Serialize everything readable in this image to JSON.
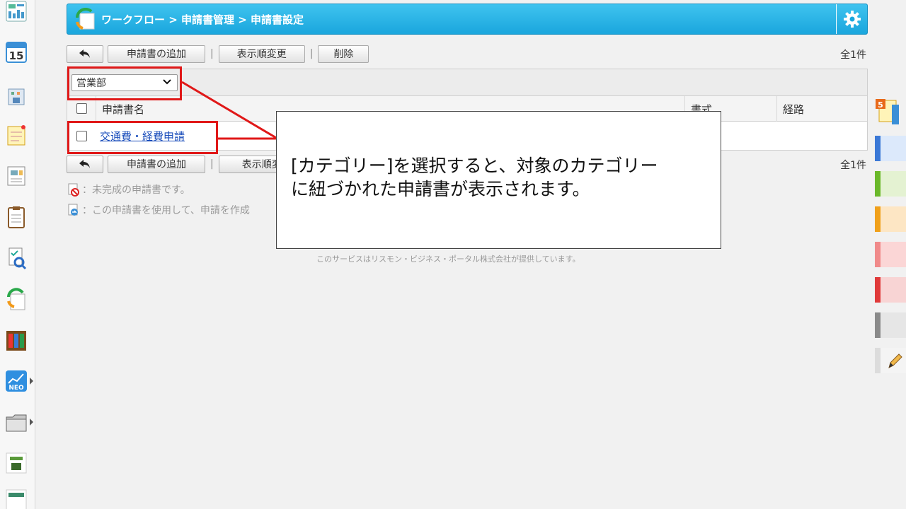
{
  "header": {
    "breadcrumb": "ワークフロー > 申請書管理 > 申請書設定"
  },
  "toolbar": {
    "add_label": "申請書の追加",
    "sort_label": "表示順変更",
    "delete_label": "削除",
    "separator": "|",
    "count_label": "全1件"
  },
  "category_select": {
    "value": "営業部"
  },
  "table": {
    "headers": [
      "申請書名",
      "書式",
      "経路"
    ],
    "rows": [
      {
        "name": "交通費・経費申請"
      }
    ]
  },
  "bottom_toolbar": {
    "add_label": "申請書の追加",
    "sort_label": "表示順変",
    "count_label": "全1件"
  },
  "legend": {
    "incomplete": "：未完成の申請書です。",
    "usable": "：この申請書を使用して、申請を作成"
  },
  "footer": {
    "text": "このサービスはリスモン・ビジネス・ポータル株式会社が提供しています。"
  },
  "callout": {
    "line1": "[カテゴリー]を選択すると、対象のカテゴリー",
    "line2": "に紐づかれた申請書が表示されます。"
  },
  "sidebar": {
    "calendar_day": "15",
    "neo_label": "NEO"
  },
  "right_tabs": {
    "badge": "5"
  },
  "colors": {
    "header_blue": "#1aa6dd",
    "highlight_red": "#e01818",
    "link_blue": "#1a4dbb"
  }
}
